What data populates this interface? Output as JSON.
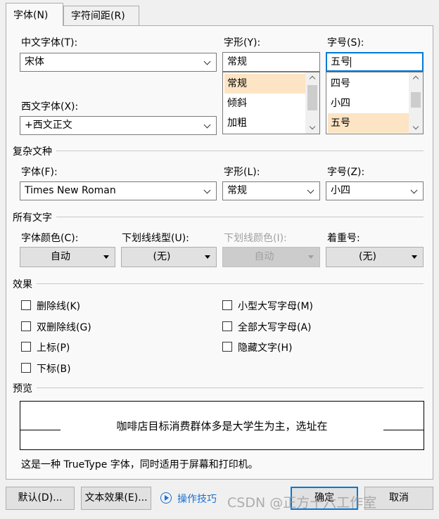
{
  "tabs": [
    {
      "label": "字体(N)"
    },
    {
      "label": "字符间距(R)"
    }
  ],
  "font": {
    "chinese_label": "中文字体(T):",
    "chinese_value": "宋体",
    "western_label": "西文字体(X):",
    "western_value": "+西文正文",
    "style_label": "字形(Y):",
    "style_value": "常规",
    "style_options": [
      "常规",
      "倾斜",
      "加粗"
    ],
    "size_label": "字号(S):",
    "size_value": "五号",
    "size_options": [
      "四号",
      "小四",
      "五号"
    ]
  },
  "complex": {
    "section": "复杂文种",
    "font_label": "字体(F):",
    "font_value": "Times New Roman",
    "style_label": "字形(L):",
    "style_value": "常规",
    "size_label": "字号(Z):",
    "size_value": "小四"
  },
  "all_text": {
    "section": "所有文字",
    "color_label": "字体颜色(C):",
    "color_value": "自动",
    "underline_label": "下划线线型(U):",
    "underline_value": "(无)",
    "underline_color_label": "下划线颜色(I):",
    "underline_color_value": "自动",
    "emphasis_label": "着重号:",
    "emphasis_value": "(无)"
  },
  "effects": {
    "section": "效果",
    "items": [
      {
        "label": "删除线(K)",
        "checked": false
      },
      {
        "label": "双删除线(G)",
        "checked": false
      },
      {
        "label": "上标(P)",
        "checked": false
      },
      {
        "label": "下标(B)",
        "checked": false
      },
      {
        "label": "小型大写字母(M)",
        "checked": false
      },
      {
        "label": "全部大写字母(A)",
        "checked": false
      },
      {
        "label": "隐藏文字(H)",
        "checked": false
      }
    ]
  },
  "preview": {
    "section": "预览",
    "text": "咖啡店目标消费群体多是大学生为主，选址在",
    "note": "这是一种 TrueType 字体，同时适用于屏幕和打印机。"
  },
  "buttons": {
    "default": "默认(D)...",
    "text_effects": "文本效果(E)...",
    "tips": "操作技巧",
    "ok": "确定",
    "cancel": "取消"
  },
  "watermark": "CSDN @正方十六工作室",
  "colors": {
    "accent": "#0078d7",
    "selection": "#fce4c4",
    "link": "#1a6fd0"
  }
}
